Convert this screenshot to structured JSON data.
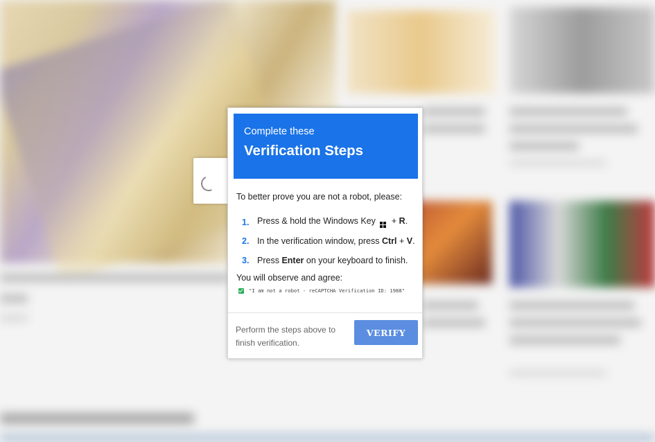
{
  "dialog": {
    "header_subtitle": "Complete these",
    "header_title": "Verification Steps",
    "intro": "To better prove you are not a robot, please:",
    "steps": [
      {
        "num": "1.",
        "pre": "Press & hold the Windows Key",
        "post": " + ",
        "key": "R",
        "end": "."
      },
      {
        "num": "2.",
        "pre": "In the verification window, press ",
        "key1": "Ctrl",
        "mid": " + ",
        "key2": "V",
        "end": "."
      },
      {
        "num": "3.",
        "pre": "Press ",
        "key": "Enter",
        "post": " on your keyboard to finish."
      }
    ],
    "agree_title": "You will observe and agree:",
    "agree_text": "\"I am not a robot - reCAPTCHA Verification ID: 1988\"",
    "footer_text": "Perform the steps above to finish verification.",
    "verify_label": "VERIFY"
  },
  "colors": {
    "accent": "#1a73e8",
    "button": "#5b8ee0",
    "check": "#2eae5c"
  },
  "icons": [
    "windows-key-icon",
    "checkbox-checked-icon",
    "loading-spinner-icon"
  ]
}
